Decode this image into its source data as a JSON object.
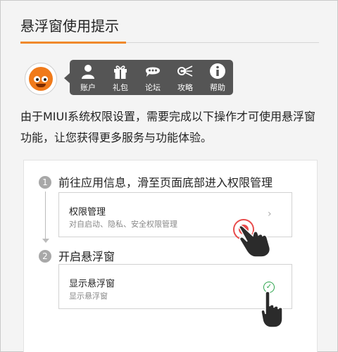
{
  "dialog": {
    "title": "悬浮窗使用提示",
    "description": "由于MIUI系统权限设置，需要完成以下操作才可使用悬浮窗功能，让您获得更多服务与功能体验。"
  },
  "toolbar": {
    "items": [
      {
        "label": "账户",
        "icon": "user-icon"
      },
      {
        "label": "礼包",
        "icon": "gift-icon"
      },
      {
        "label": "论坛",
        "icon": "chat-icon"
      },
      {
        "label": "攻略",
        "icon": "strategy-icon"
      },
      {
        "label": "帮助",
        "icon": "info-icon"
      }
    ]
  },
  "steps": [
    {
      "number": "1",
      "text": "前往应用信息，滑至页面底部进入权限管理",
      "card": {
        "title": "权限管理",
        "subtitle": "对自启动、隐私、安全权限管理"
      }
    },
    {
      "number": "2",
      "text": "开启悬浮窗",
      "card": {
        "title": "显示悬浮窗",
        "subtitle": "显示悬浮窗"
      }
    }
  ],
  "colors": {
    "accent": "#f0892c",
    "toolbar_bg": "#555555",
    "tap_indicator": "#e84b4b",
    "check": "#2aa34a"
  }
}
